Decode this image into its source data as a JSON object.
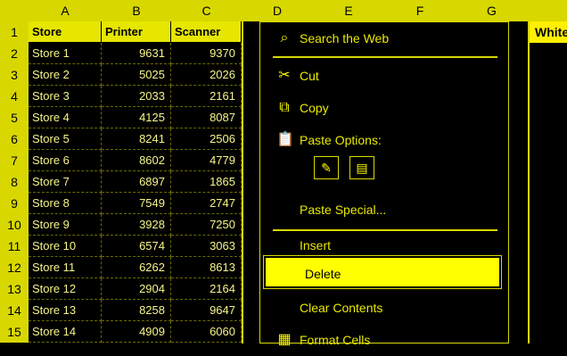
{
  "columns": [
    "A",
    "B",
    "C",
    "D",
    "E",
    "F",
    "G"
  ],
  "rows": [
    "1",
    "2",
    "3",
    "4",
    "5",
    "6",
    "7",
    "8",
    "9",
    "10",
    "11",
    "12",
    "13",
    "14",
    "15"
  ],
  "headers": [
    "Store",
    "Printer",
    "Scanner"
  ],
  "table": [
    [
      "Store 1",
      "9631",
      "9370"
    ],
    [
      "Store 2",
      "5025",
      "2026"
    ],
    [
      "Store 3",
      "2033",
      "2161"
    ],
    [
      "Store 4",
      "4125",
      "8087"
    ],
    [
      "Store 5",
      "8241",
      "2506"
    ],
    [
      "Store 6",
      "8602",
      "4779"
    ],
    [
      "Store 7",
      "6897",
      "1865"
    ],
    [
      "Store 8",
      "7549",
      "2747"
    ],
    [
      "Store 9",
      "3928",
      "7250"
    ],
    [
      "Store 10",
      "6574",
      "3063"
    ],
    [
      "Store 11",
      "6262",
      "8613"
    ],
    [
      "Store 12",
      "2904",
      "2164"
    ],
    [
      "Store 13",
      "8258",
      "9647"
    ],
    [
      "Store 14",
      "4909",
      "6060"
    ]
  ],
  "right_header": "White",
  "context_menu": {
    "items": [
      {
        "label": "Search the Web",
        "icon": "search-icon"
      },
      {
        "label": "Cut",
        "icon": "scissors-icon"
      },
      {
        "label": "Copy",
        "icon": "copy-icon"
      },
      {
        "label": "Paste Options:",
        "icon": "paste-icon"
      },
      {
        "label": "Paste Special...",
        "icon": ""
      },
      {
        "label": "Insert",
        "icon": ""
      },
      {
        "label": "Delete",
        "icon": ""
      },
      {
        "label": "Clear Contents",
        "icon": ""
      },
      {
        "label": "Format Cells",
        "icon": "format-cells-icon"
      }
    ],
    "paste_buttons": [
      "paste-keep-source-icon",
      "paste-values-icon"
    ]
  }
}
